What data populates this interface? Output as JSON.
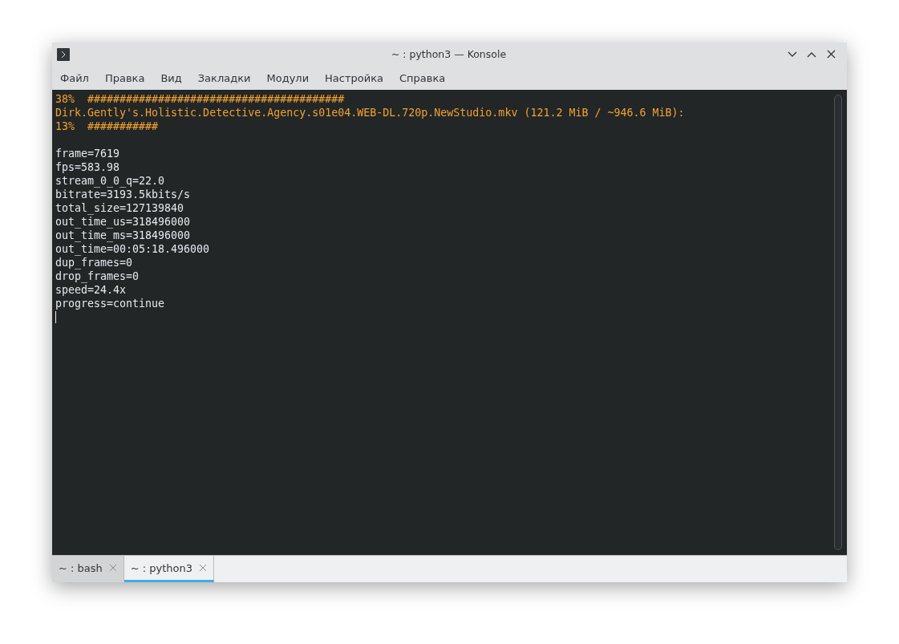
{
  "window": {
    "title": "~ : python3 — Konsole"
  },
  "menu": [
    "Файл",
    "Правка",
    "Вид",
    "Закладки",
    "Модули",
    "Настройка",
    "Справка"
  ],
  "terminal": {
    "lines": [
      {
        "kind": "highlight",
        "text": "38%  ########################################"
      },
      {
        "kind": "highlight",
        "text": "Dirk.Gently's.Holistic.Detective.Agency.s01e04.WEB-DL.720p.NewStudio.mkv (121.2 MiB / ~946.6 MiB):"
      },
      {
        "kind": "highlight",
        "text": "13%  ###########"
      },
      {
        "kind": "blank"
      },
      {
        "kind": "plain",
        "text": "frame=7619"
      },
      {
        "kind": "plain",
        "text": "fps=583.98"
      },
      {
        "kind": "plain",
        "text": "stream_0_0_q=22.0"
      },
      {
        "kind": "plain",
        "text": "bitrate=3193.5kbits/s"
      },
      {
        "kind": "plain",
        "text": "total_size=127139840"
      },
      {
        "kind": "plain",
        "text": "out_time_us=318496000"
      },
      {
        "kind": "plain",
        "text": "out_time_ms=318496000"
      },
      {
        "kind": "plain",
        "text": "out_time=00:05:18.496000"
      },
      {
        "kind": "plain",
        "text": "dup_frames=0"
      },
      {
        "kind": "plain",
        "text": "drop_frames=0"
      },
      {
        "kind": "plain",
        "text": "speed=24.4x"
      },
      {
        "kind": "plain",
        "text": "progress=continue"
      },
      {
        "kind": "cursor"
      }
    ]
  },
  "tabs": [
    {
      "label": "~ : bash",
      "selected": false
    },
    {
      "label": "~ : python3",
      "selected": true
    }
  ]
}
